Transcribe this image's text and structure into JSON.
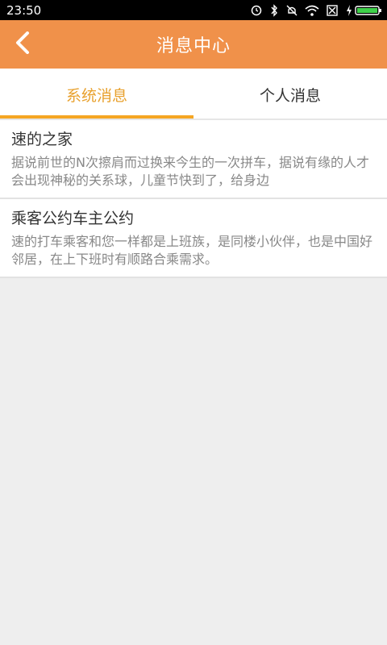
{
  "status_bar": {
    "time": "23:50"
  },
  "header": {
    "title": "消息中心",
    "back_icon": "chevron-left-icon"
  },
  "tabs": [
    {
      "label": "系统消息",
      "active": true
    },
    {
      "label": "个人消息",
      "active": false
    }
  ],
  "messages": [
    {
      "title": "速的之家",
      "body": "据说前世的N次擦肩而过换来今生的一次拼车，据说有缘的人才会出现神秘的关系球，儿童节快到了，给身边"
    },
    {
      "title": "乘客公约车主公约",
      "body": "速的打车乘客和您一样都是上班族，是同楼小伙伴，也是中国好邻居，在上下班时有顺路合乘需求。"
    }
  ],
  "colors": {
    "accent": "#f0914a",
    "tab_active": "#e8a12e",
    "tab_indicator": "#f5a623",
    "background": "#eeeeee"
  }
}
